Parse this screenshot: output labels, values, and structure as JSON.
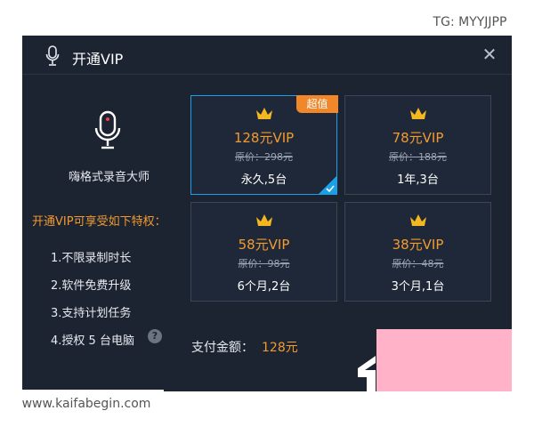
{
  "watermarks": {
    "top_right": "TG: MYYJJPP",
    "bottom_left": "www.kaifabegin.com"
  },
  "dialog": {
    "title": "开通VIP",
    "app_name": "嗨格式录音大师",
    "privileges_heading": "开通VIP可享受如下特权：",
    "privileges": [
      "1.不限录制时长",
      "2.软件免费升级",
      "3.支持计划任务",
      "4.授权 5 台电脑"
    ],
    "help_icon": "?",
    "plans": [
      {
        "price": "128元VIP",
        "original": "原价：298元",
        "detail": "永久,5台",
        "badge": "超值",
        "selected": true
      },
      {
        "price": "78元VIP",
        "original": "原价：188元",
        "detail": "1年,3台"
      },
      {
        "price": "58元VIP",
        "original": "原价：98元",
        "detail": "6个月,2台"
      },
      {
        "price": "38元VIP",
        "original": "原价：48元",
        "detail": "3个月,1台"
      }
    ],
    "payment": {
      "label": "支付金额：",
      "amount": "128元"
    },
    "icons": {
      "title": "microphone-icon",
      "logo": "microphone-icon",
      "crown": "crown-icon",
      "close": "close-icon",
      "help": "help-icon",
      "selected": "checkmark-icon"
    },
    "colors": {
      "background": "#1c2431",
      "accent": "#f39a2f",
      "selected_border": "#1aa0e6",
      "badge": "#f0872a"
    }
  }
}
